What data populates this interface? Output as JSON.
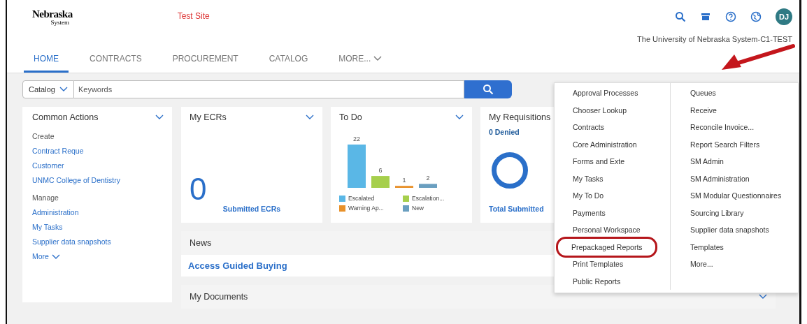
{
  "header": {
    "logo": {
      "name": "Nebraska",
      "sub": "System"
    },
    "site_label": "Test Site",
    "avatar": "DJ",
    "org": "The University of Nebraska System-C1-TEST"
  },
  "tabs": [
    {
      "label": "HOME",
      "selected": true
    },
    {
      "label": "CONTRACTS",
      "selected": false
    },
    {
      "label": "PROCUREMENT",
      "selected": false
    },
    {
      "label": "CATALOG",
      "selected": false
    },
    {
      "label": "MORE...",
      "selected": false
    }
  ],
  "search": {
    "scope": "Catalog",
    "placeholder": "Keywords"
  },
  "common_actions": {
    "title": "Common Actions",
    "items": [
      {
        "text": "Create",
        "kind": "heading"
      },
      {
        "text": "Contract Reque",
        "kind": "link"
      },
      {
        "text": "Customer",
        "kind": "link"
      },
      {
        "text": "UNMC College of Dentistry",
        "kind": "link"
      },
      {
        "text": "Manage",
        "kind": "heading"
      },
      {
        "text": "Administration",
        "kind": "link"
      },
      {
        "text": "My Tasks",
        "kind": "link"
      },
      {
        "text": "Supplier data snapshots",
        "kind": "link"
      },
      {
        "text": "More",
        "kind": "more"
      }
    ]
  },
  "my_ecrs": {
    "title": "My ECRs",
    "value": "0",
    "caption": "Submitted ECRs"
  },
  "to_do": {
    "title": "To Do",
    "chart_data": {
      "type": "bar",
      "data_labels": true,
      "series": [
        {
          "name": "Escalated",
          "color": "#5ab7e6",
          "values": [
            22
          ]
        },
        {
          "name": "Escalation...",
          "color": "#a6cf4c",
          "values": [
            6
          ]
        },
        {
          "name": "Warning Ap...",
          "color": "#e8912a",
          "values": [
            1
          ]
        },
        {
          "name": "New",
          "color": "#6a9fc0",
          "values": [
            2
          ]
        }
      ]
    }
  },
  "my_requisitions": {
    "title": "My Requisitions",
    "denied": "0 Denied",
    "caption": "Total Submitted"
  },
  "news": {
    "title": "News",
    "headline": "Access Guided Buying"
  },
  "my_documents": {
    "title": "My Documents"
  },
  "menu": {
    "columns": [
      [
        {
          "label": "Approval Processes",
          "circled": false
        },
        {
          "label": "Chooser Lookup",
          "circled": false
        },
        {
          "label": "Contracts",
          "circled": false
        },
        {
          "label": "Core Administration",
          "circled": false
        },
        {
          "label": "Forms and Exte",
          "circled": false
        },
        {
          "label": "My Tasks",
          "circled": false
        },
        {
          "label": "My To Do",
          "circled": false
        },
        {
          "label": "Payments",
          "circled": false
        },
        {
          "label": "Personal Workspace",
          "circled": false
        },
        {
          "label": "Prepackaged Reports",
          "circled": true
        },
        {
          "label": "Print Templates",
          "circled": false
        },
        {
          "label": "Public Reports",
          "circled": false
        }
      ],
      [
        {
          "label": "Queues",
          "circled": false
        },
        {
          "label": "Receive",
          "circled": false
        },
        {
          "label": "Reconcile Invoice...",
          "circled": false
        },
        {
          "label": "Report Search Filters",
          "circled": false
        },
        {
          "label": "SM Admin",
          "circled": false
        },
        {
          "label": "SM Administration",
          "circled": false
        },
        {
          "label": "SM Modular Questionnaires",
          "circled": false
        },
        {
          "label": "Sourcing Library",
          "circled": false
        },
        {
          "label": "Supplier data snapshots",
          "circled": false
        },
        {
          "label": "Templates",
          "circled": false
        },
        {
          "label": "More...",
          "circled": false
        }
      ]
    ]
  }
}
